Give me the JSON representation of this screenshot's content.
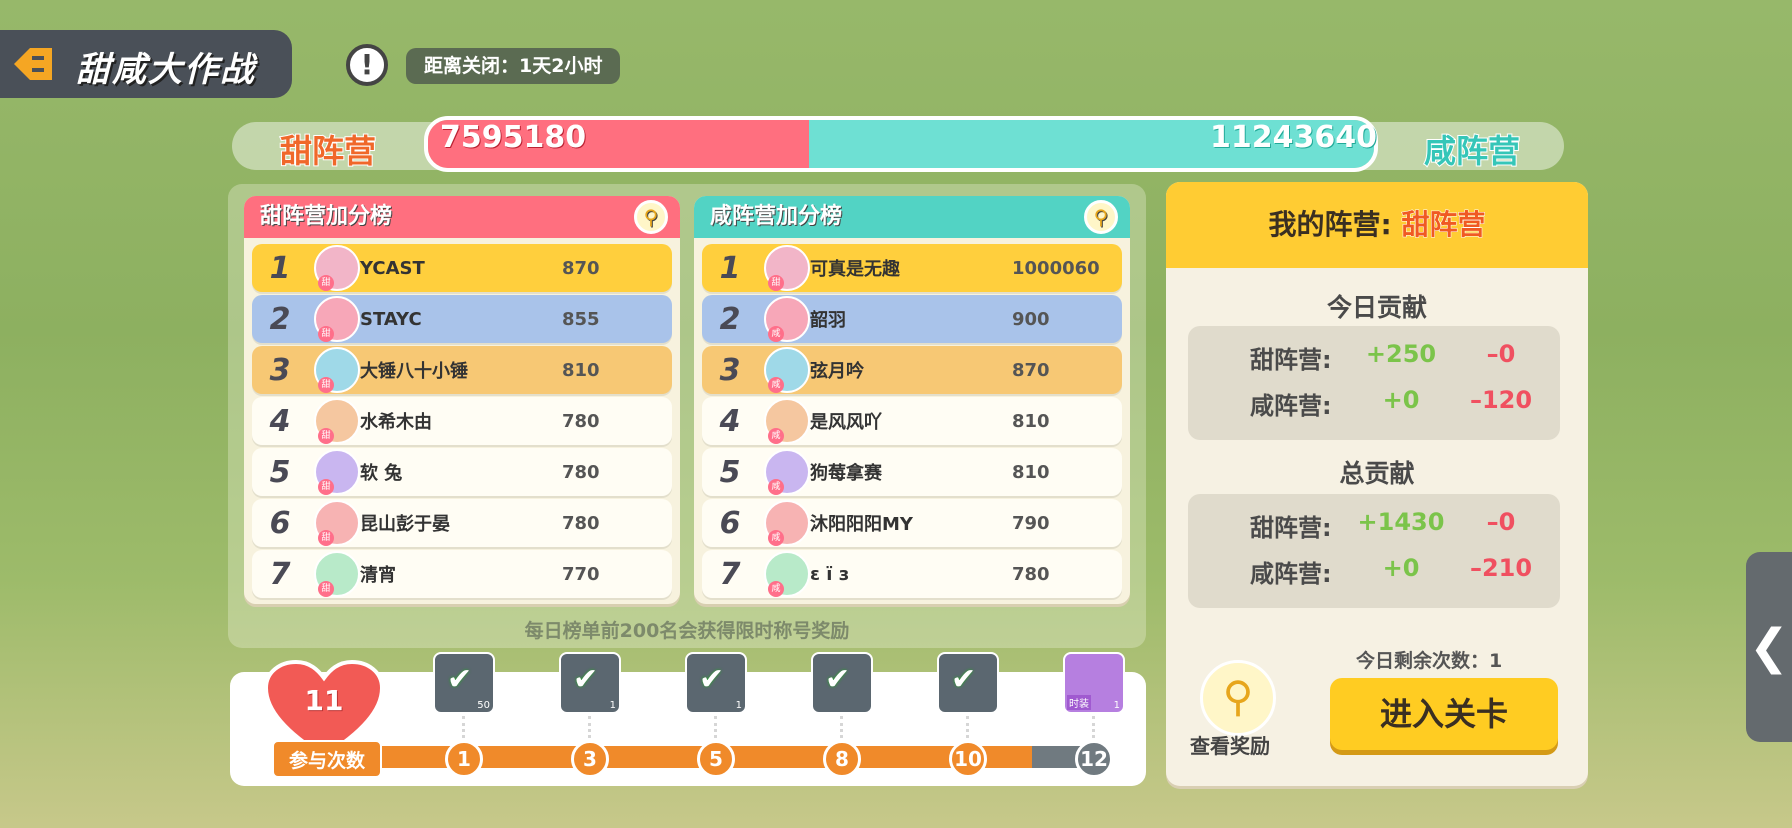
{
  "header": {
    "title": "甜咸大作战",
    "timer": "距离关闭：1天2小时"
  },
  "score": {
    "sweet_label": "甜阵营",
    "salty_label": "咸阵营",
    "sweet": "7595180",
    "salty": "11243640",
    "sweet_fraction": 0.403
  },
  "sweet_board": {
    "title": "甜阵营加分榜",
    "rows": [
      {
        "rank": "1",
        "name": "YCAST",
        "score": "870",
        "tag": "甜"
      },
      {
        "rank": "2",
        "name": "STAYC",
        "score": "855",
        "tag": "甜"
      },
      {
        "rank": "3",
        "name": "大锤八十小锤",
        "score": "810",
        "tag": "甜"
      },
      {
        "rank": "4",
        "name": "水希木由",
        "score": "780",
        "tag": "甜"
      },
      {
        "rank": "5",
        "name": "软 兔",
        "score": "780",
        "tag": "甜"
      },
      {
        "rank": "6",
        "name": "昆山彭于晏",
        "score": "780",
        "tag": "甜"
      },
      {
        "rank": "7",
        "name": "清宵",
        "score": "770",
        "tag": "甜"
      }
    ]
  },
  "salty_board": {
    "title": "咸阵营加分榜",
    "rows": [
      {
        "rank": "1",
        "name": "可真是无趣",
        "score": "1000060",
        "tag": "甜"
      },
      {
        "rank": "2",
        "name": "韶羽",
        "score": "900",
        "tag": "咸"
      },
      {
        "rank": "3",
        "name": "弦月吟",
        "score": "870",
        "tag": "咸"
      },
      {
        "rank": "4",
        "name": "是风风吖",
        "score": "810",
        "tag": "咸"
      },
      {
        "rank": "5",
        "name": "狗莓拿赛",
        "score": "810",
        "tag": "咸"
      },
      {
        "rank": "6",
        "name": "沐阳阳阳MY",
        "score": "790",
        "tag": "咸"
      },
      {
        "rank": "7",
        "name": "ε ї з",
        "score": "780",
        "tag": "咸"
      }
    ]
  },
  "note": "每日榜单前200名会获得限时称号奖励",
  "progress": {
    "count": "11",
    "count_label": "参与次数",
    "milestones": [
      "1",
      "3",
      "5",
      "8",
      "10",
      "12"
    ],
    "rewards": [
      {
        "qty": "50",
        "claimed": true
      },
      {
        "qty": "1",
        "claimed": true
      },
      {
        "qty": "1",
        "claimed": true
      },
      {
        "qty": "",
        "claimed": true
      },
      {
        "qty": "",
        "claimed": true
      },
      {
        "qty": "1",
        "claimed": false,
        "tag": "时装"
      }
    ]
  },
  "panel": {
    "my_team_prefix": "我的阵营:",
    "my_team": "甜阵营",
    "today_title": "今日贡献",
    "today": [
      {
        "label": "甜阵营:",
        "plus": "+250",
        "minus": "–0"
      },
      {
        "label": "咸阵营:",
        "plus": "+0",
        "minus": "–120"
      }
    ],
    "total_title": "总贡献",
    "total": [
      {
        "label": "甜阵营:",
        "plus": "+1430",
        "minus": "–0"
      },
      {
        "label": "咸阵营:",
        "plus": "+0",
        "minus": "–210"
      }
    ],
    "remain": "今日剩余次数：1",
    "view_label": "查看奖励",
    "enter_label": "进入关卡"
  },
  "colors": {
    "sweet": "#ff6f7f",
    "salty": "#6ee0d3",
    "gold": "#ffcc33",
    "orange": "#f08a2a"
  }
}
